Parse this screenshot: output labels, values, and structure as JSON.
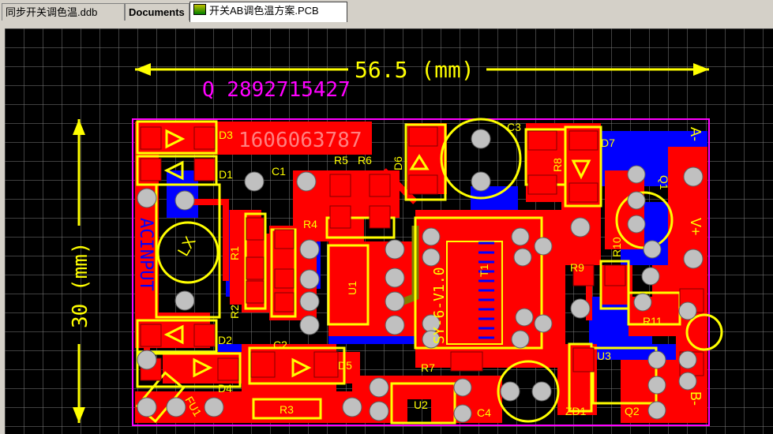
{
  "tabs": [
    {
      "label": "同步开关调色温.ddb",
      "active": false
    },
    {
      "label": "Documents",
      "active": false
    },
    {
      "label": "开关AB调色温方案.PCB",
      "active": true
    }
  ],
  "pcb": {
    "dimension_h": "56.5 (mm)",
    "dimension_v": "30 (mm)",
    "contact": "Q 2892715427",
    "board_number": "1606063787",
    "version_text": "SY-6-V1.0",
    "ref_labels": {
      "D3": "D3",
      "D1": "D1",
      "C1": "C1",
      "R5": "R5",
      "R6": "R6",
      "D6": "D6",
      "C3": "C3",
      "R8": "R8",
      "D7": "D7",
      "Q1": "Q1",
      "R4": "R4",
      "R1": "R1",
      "R2": "R2",
      "U1": "U1",
      "T1": "T1",
      "R9": "R9",
      "R10": "R10",
      "R11": "R11",
      "D2": "D2",
      "C2": "C2",
      "D5": "D5",
      "R7": "R7",
      "U3": "U3",
      "D4": "D4",
      "FU1": "FU1",
      "R3": "R3",
      "U2": "U2",
      "C4": "C4",
      "ZD1": "ZD1",
      "Q2": "Q2",
      "ACINPUT": "ACINPUT",
      "LX": "LX",
      "Aminus": "A-",
      "Vplus": "V+",
      "Bminus": "B-"
    }
  },
  "colors": {
    "background": "#000000",
    "grid": "#7f7f7f",
    "top_copper": "#ff0000",
    "bottom_copper": "#0000ff",
    "overlay": "#ffff00",
    "keepout": "#ff00ff",
    "pad": "#c0c0c0",
    "via": "#808000"
  }
}
